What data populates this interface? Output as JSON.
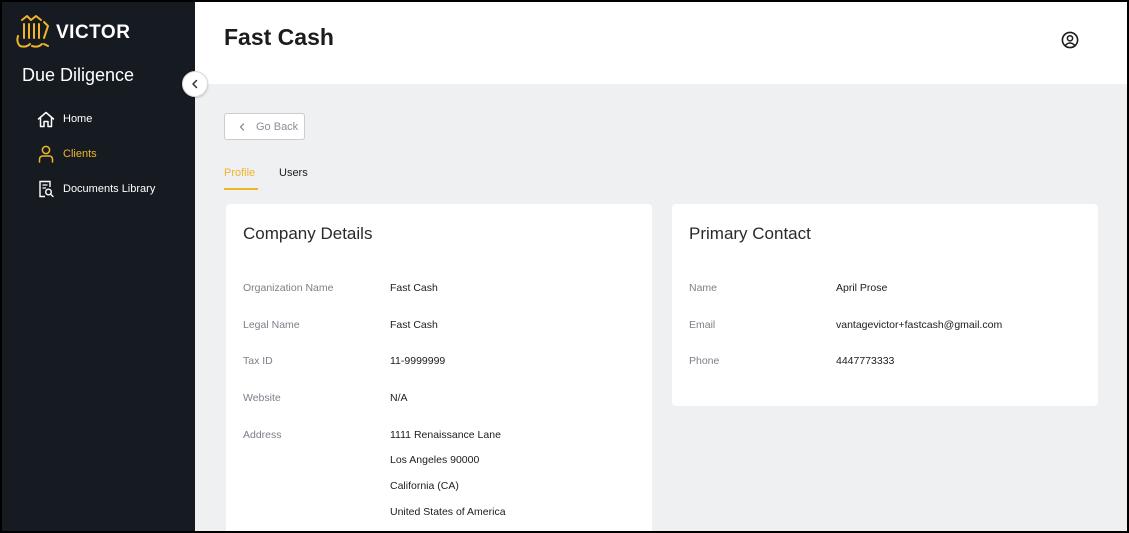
{
  "brand": {
    "name": "VICTOR",
    "accent": "#f0b429"
  },
  "sidebar": {
    "app_title": "Due Diligence",
    "items": [
      {
        "label": "Home",
        "icon": "home-icon",
        "active": false
      },
      {
        "label": "Clients",
        "icon": "user-icon",
        "active": true
      },
      {
        "label": "Documents Library",
        "icon": "document-search-icon",
        "active": false
      }
    ]
  },
  "header": {
    "title": "Fast Cash"
  },
  "go_back_label": "Go Back",
  "tabs": [
    {
      "label": "Profile",
      "active": true
    },
    {
      "label": "Users",
      "active": false
    }
  ],
  "company_details": {
    "title": "Company Details",
    "rows": [
      {
        "label": "Organization Name",
        "value": "Fast Cash"
      },
      {
        "label": "Legal Name",
        "value": "Fast Cash"
      },
      {
        "label": "Tax ID",
        "value": "11-9999999"
      },
      {
        "label": "Website",
        "value": "N/A"
      },
      {
        "label": "Address",
        "lines": [
          "1111 Renaissance Lane",
          "Los Angeles 90000",
          "California (CA)",
          "United States of America"
        ]
      }
    ]
  },
  "primary_contact": {
    "title": "Primary Contact",
    "rows": [
      {
        "label": "Name",
        "value": "April Prose"
      },
      {
        "label": "Email",
        "value": "vantagevictor+fastcash@gmail.com"
      },
      {
        "label": "Phone",
        "value": "4447773333"
      }
    ]
  }
}
